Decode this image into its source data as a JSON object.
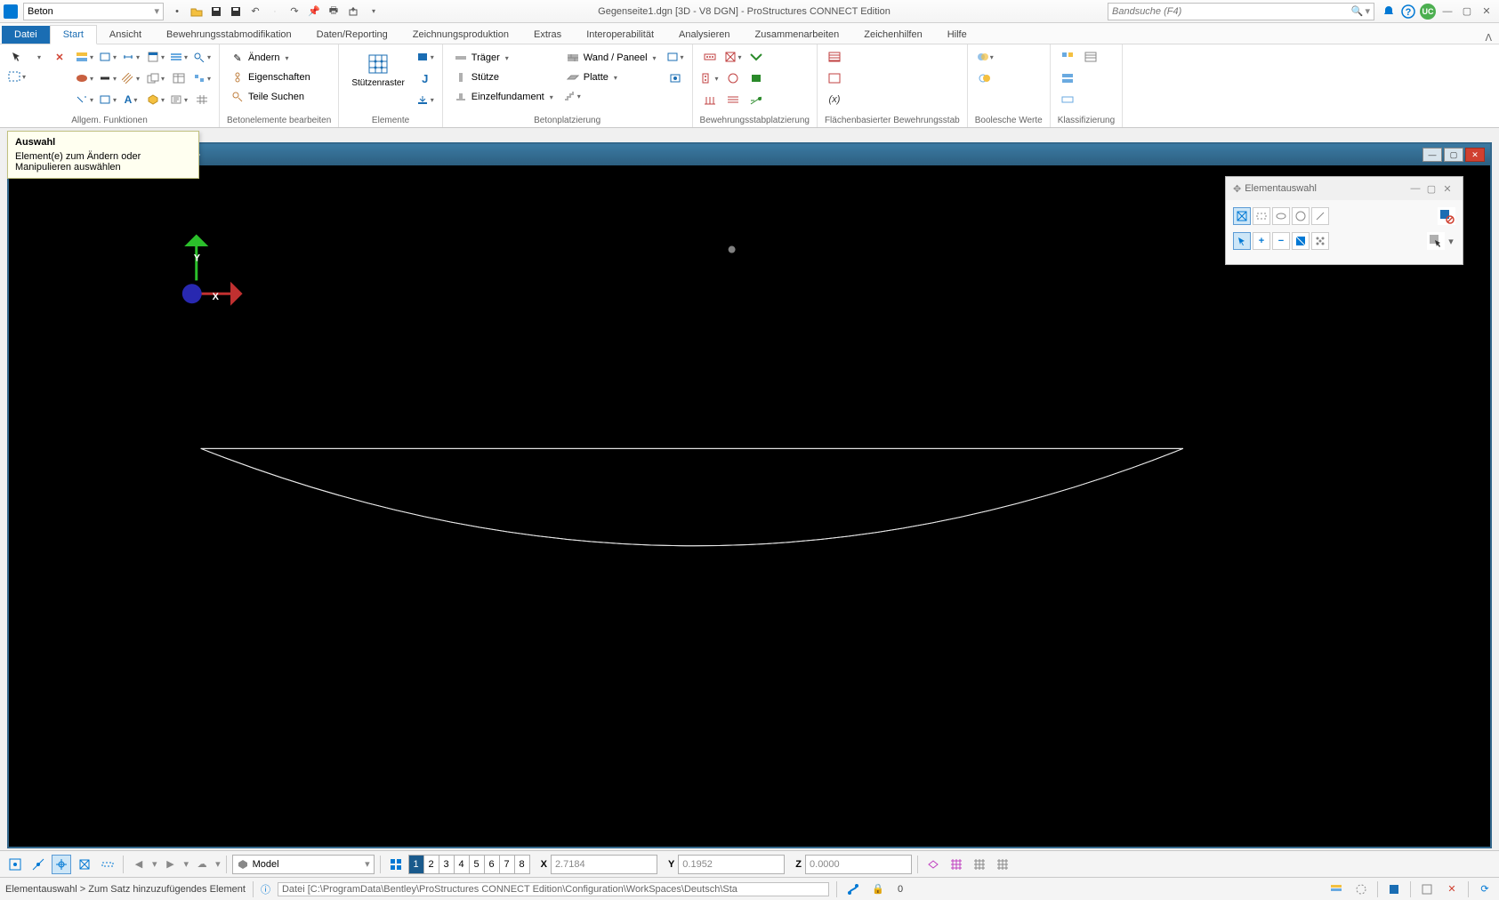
{
  "titlebar": {
    "workflow": "Beton",
    "title": "Gegenseite1.dgn [3D - V8 DGN] - ProStructures CONNECT Edition",
    "search_placeholder": "Bandsuche (F4)",
    "user_badge": "UC"
  },
  "tabs": {
    "file": "Datei",
    "items": [
      "Start",
      "Ansicht",
      "Bewehrungsstabmodifikation",
      "Daten/Reporting",
      "Zeichnungsproduktion",
      "Extras",
      "Interoperabilität",
      "Analysieren",
      "Zusammenarbeiten",
      "Zeichenhilfen",
      "Hilfe"
    ],
    "active": 0
  },
  "ribbon": {
    "g_allgem": "Allgem. Funktionen",
    "g_beton": "Betonelemente bearbeiten",
    "g_elemente": "Elemente",
    "g_platz": "Betonplatzierung",
    "g_bewehr": "Bewehrungsstabplatzierung",
    "g_flach": "Flächenbasierter Bewehrungsstab",
    "g_bool": "Boolesche Werte",
    "g_klass": "Klassifizierung",
    "aendern": "Ändern",
    "eigenschaften": "Eigenschaften",
    "teile": "Teile Suchen",
    "stuetzen": "Stützenraster",
    "traeger": "Träger",
    "stuetze": "Stütze",
    "einzelf": "Einzelfundament",
    "wand": "Wand / Paneel",
    "platte": "Platte"
  },
  "tooltip": {
    "title": "Auswahl",
    "body": "Element(e) zum Ändern oder Manipulieren auswählen"
  },
  "view": {
    "toolbar_spacer": ""
  },
  "palette": {
    "title": "Elementauswahl"
  },
  "bottbar": {
    "model": "Model",
    "views": [
      "1",
      "2",
      "3",
      "4",
      "5",
      "6",
      "7",
      "8"
    ],
    "active_view": 0,
    "x_label": "X",
    "x_val": "2.7184",
    "y_label": "Y",
    "y_val": "0.1952",
    "z_label": "Z",
    "z_val": "0.0000"
  },
  "status": {
    "left": "Elementauswahl  >  Zum Satz hinzuzufügendes Element",
    "file": "Datei [C:\\ProgramData\\Bentley\\ProStructures CONNECT Edition\\Configuration\\WorkSpaces\\Deutsch\\Sta",
    "count": "0"
  }
}
